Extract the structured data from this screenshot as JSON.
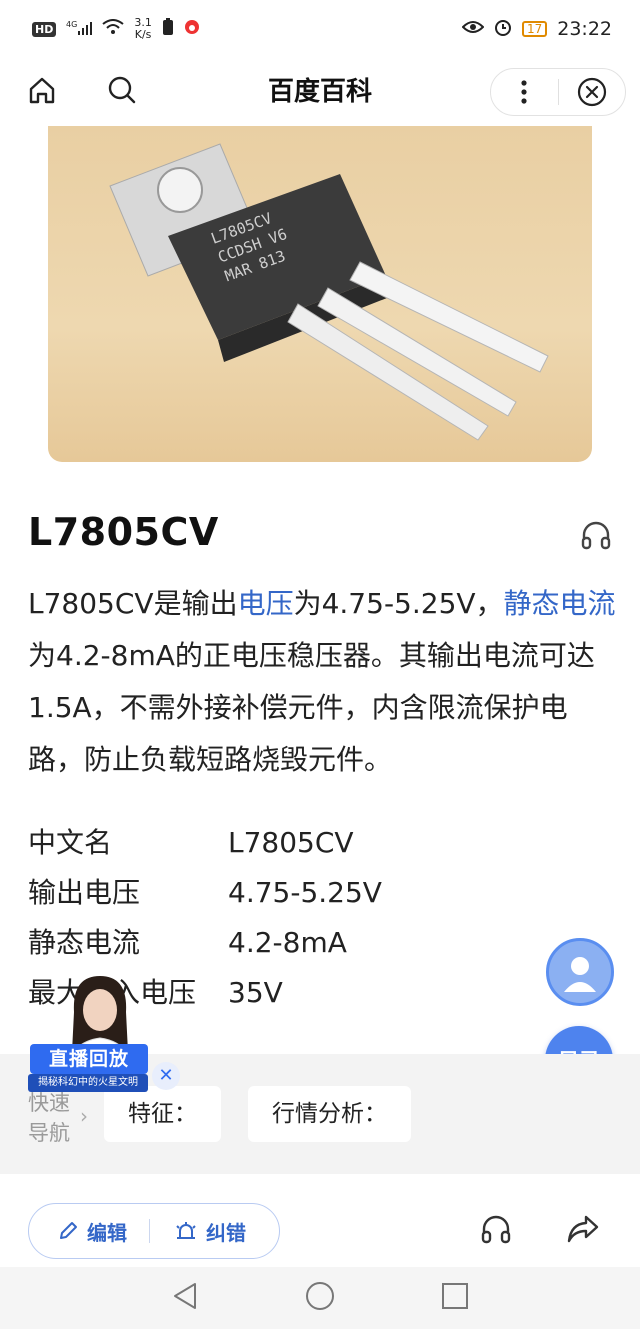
{
  "status_bar": {
    "hd": "HD",
    "signal": "4G",
    "speed_value": "3.1",
    "speed_unit": "K/s",
    "battery": "17",
    "time": "23:22"
  },
  "header": {
    "title": "百度百科",
    "icons": [
      "home-icon",
      "search-icon",
      "more-icon",
      "close-icon"
    ]
  },
  "article": {
    "title": "L7805CV",
    "summary": {
      "p1": "L7805CV是输出",
      "link1": "电压",
      "p2": "为4.75-5.25V，",
      "link2": "静态电流",
      "p3": "为4.2-8mA的正电压稳压器。其输出电流可达1.5A，不需外接补偿元件，内含限流保护电路，防止负载短路烧毁元件。"
    },
    "info": [
      {
        "key": "中文名",
        "value": "L7805CV"
      },
      {
        "key": "输出电压",
        "value": "4.75-5.25V"
      },
      {
        "key": "静态电流",
        "value": "4.2-8mA"
      },
      {
        "key": "最大输入电压",
        "value": "35V"
      }
    ]
  },
  "live_badge": {
    "label": "直播回放",
    "subtitle": "揭秘科幻中的火星文明"
  },
  "toc_button": "目录",
  "quick_nav": {
    "label": "快速导航",
    "chips": [
      "特征：",
      "行情分析："
    ]
  },
  "toolbar": {
    "edit_label": "编辑",
    "correct_label": "纠错"
  },
  "colors": {
    "link": "#3467c8",
    "accent": "#4e83ee"
  }
}
